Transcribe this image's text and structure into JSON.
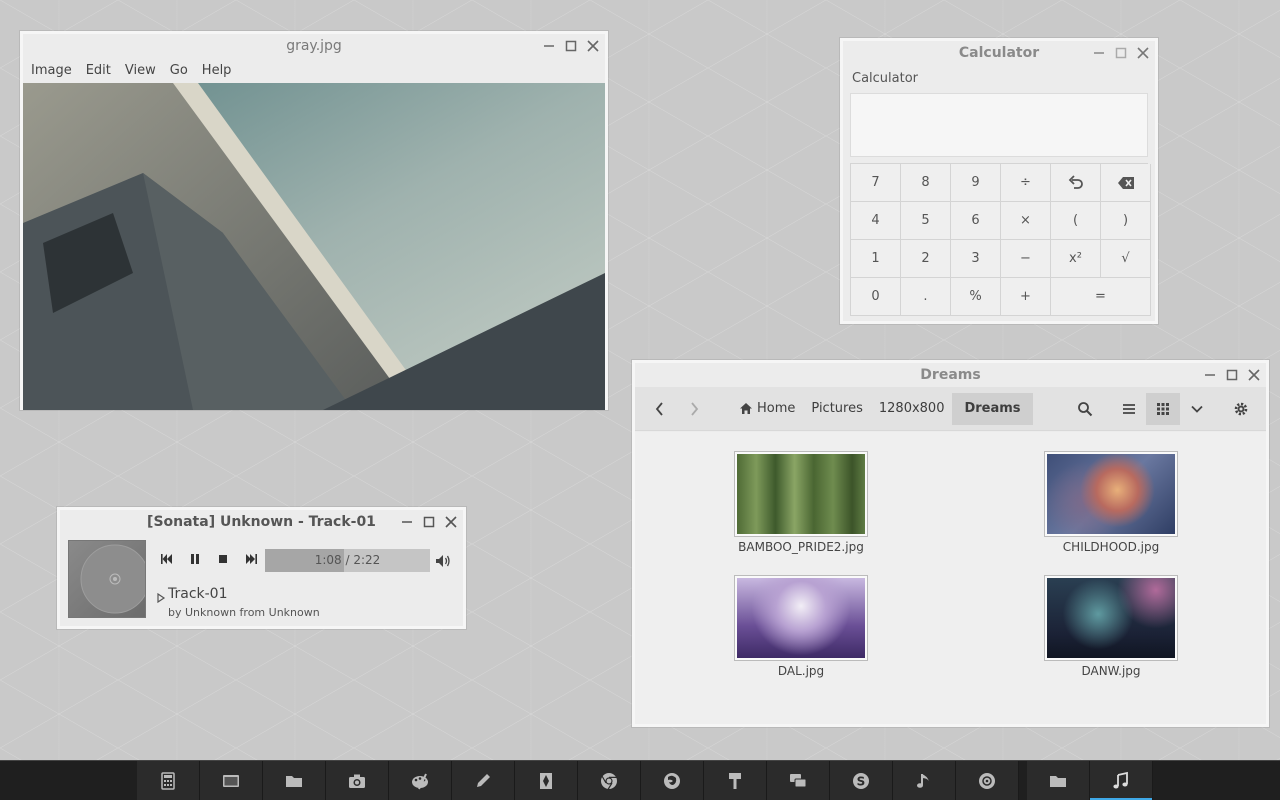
{
  "viewer": {
    "title": "gray.jpg",
    "menu": [
      "Image",
      "Edit",
      "View",
      "Go",
      "Help"
    ]
  },
  "calculator": {
    "title": "Calculator",
    "subtitle": "Calculator",
    "display": "",
    "keys": [
      "7",
      "8",
      "9",
      "÷",
      "undo",
      "backspace",
      "4",
      "5",
      "6",
      "×",
      "(",
      ")",
      "1",
      "2",
      "3",
      "−",
      "x²",
      "√",
      "0",
      ".",
      "%",
      "+",
      "="
    ]
  },
  "files": {
    "title": "Dreams",
    "breadcrumbs": [
      "Home",
      "Pictures",
      "1280x800",
      "Dreams"
    ],
    "items": [
      {
        "name": "BAMBOO_PRIDE2.jpg"
      },
      {
        "name": "CHILDHOOD.jpg"
      },
      {
        "name": "DAL.jpg"
      },
      {
        "name": "DANW.jpg"
      }
    ]
  },
  "music": {
    "title": "[Sonata] Unknown - Track-01",
    "elapsed": "1:08",
    "duration": "2:22",
    "progress_text": "1:08 / 2:22",
    "progress_fraction": 0.48,
    "track_title": "Track-01",
    "track_meta": "by Unknown from Unknown"
  },
  "taskbar": {
    "icons": [
      "calculator-icon",
      "terminal-icon",
      "files-icon",
      "camera-icon",
      "paint-icon",
      "pencil-icon",
      "ebook-icon",
      "chrome-icon",
      "firefox-icon",
      "brush-icon",
      "chat-icon",
      "skype-icon",
      "music-note-icon",
      "disc-icon",
      "folder-icon",
      "music-player-icon"
    ],
    "active_index": 15,
    "accent": "#3fa9e8"
  }
}
